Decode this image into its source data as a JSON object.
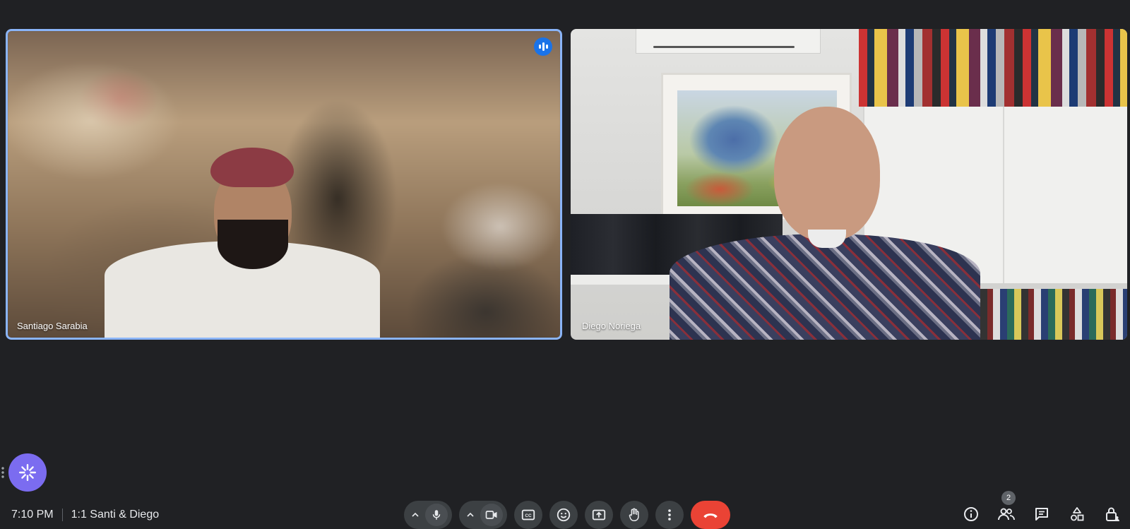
{
  "participants": [
    {
      "name": "Santiago Sarabia",
      "speaking": true
    },
    {
      "name": "Diego Noriega",
      "speaking": false
    }
  ],
  "meeting": {
    "time": "7:10 PM",
    "title": "1:1 Santi & Diego"
  },
  "people_count": "2",
  "icons": {
    "gemini": "sparkle-icon",
    "mic": "mic-icon",
    "camera": "video-icon",
    "captions": "captions-icon",
    "reactions": "emoji-icon",
    "present": "present-icon",
    "raise_hand": "hand-icon",
    "more": "more-vert-icon",
    "end_call": "call-end-icon",
    "info": "info-icon",
    "people": "people-icon",
    "chat": "chat-icon",
    "activities": "activities-icon",
    "host_controls": "lock-person-icon"
  },
  "colors": {
    "background": "#202124",
    "active_speaker_border": "#8ab4f8",
    "end_call": "#ea4335",
    "gemini_fab": "#7b6cf0"
  }
}
